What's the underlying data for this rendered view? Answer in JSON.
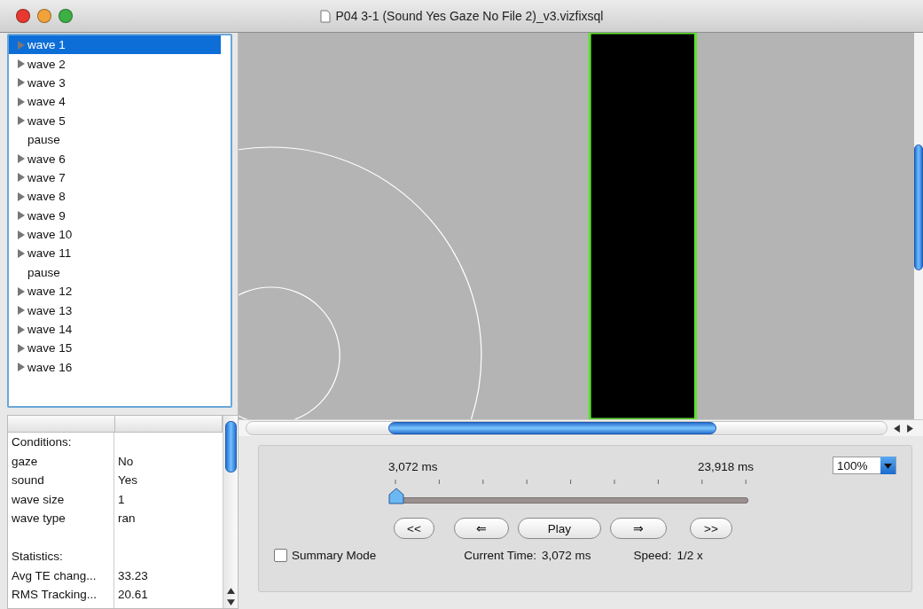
{
  "window": {
    "title": "P04 3-1 (Sound Yes Gaze No File 2)_v3.vizfixsql"
  },
  "tree": [
    {
      "label": "wave 1",
      "kind": "group",
      "expanded": false,
      "selected": true
    },
    {
      "label": "wave 2",
      "kind": "group",
      "expanded": false,
      "selected": false
    },
    {
      "label": "wave 3",
      "kind": "group",
      "expanded": false,
      "selected": false
    },
    {
      "label": "wave 4",
      "kind": "group",
      "expanded": false,
      "selected": false
    },
    {
      "label": "wave 5",
      "kind": "group",
      "expanded": false,
      "selected": false
    },
    {
      "label": "pause",
      "kind": "leaf",
      "selected": false
    },
    {
      "label": "wave 6",
      "kind": "group",
      "expanded": false,
      "selected": false
    },
    {
      "label": "wave 7",
      "kind": "group",
      "expanded": false,
      "selected": false
    },
    {
      "label": "wave 8",
      "kind": "group",
      "expanded": false,
      "selected": false
    },
    {
      "label": "wave 9",
      "kind": "group",
      "expanded": false,
      "selected": false
    },
    {
      "label": "wave 10",
      "kind": "group",
      "expanded": false,
      "selected": false
    },
    {
      "label": "wave 11",
      "kind": "group",
      "expanded": false,
      "selected": false
    },
    {
      "label": "pause",
      "kind": "leaf",
      "selected": false
    },
    {
      "label": "wave 12",
      "kind": "group",
      "expanded": false,
      "selected": false
    },
    {
      "label": "wave 13",
      "kind": "group",
      "expanded": false,
      "selected": false
    },
    {
      "label": "wave 14",
      "kind": "group",
      "expanded": false,
      "selected": false
    },
    {
      "label": "wave 15",
      "kind": "group",
      "expanded": false,
      "selected": false
    },
    {
      "label": "wave 16",
      "kind": "group",
      "expanded": false,
      "selected": false
    }
  ],
  "table": {
    "rows": [
      {
        "kind": "heading",
        "column_1": "Conditions:"
      },
      {
        "kind": "pair",
        "column_1": "gaze",
        "column_2": "No"
      },
      {
        "kind": "pair",
        "column_1": "sound",
        "column_2": "Yes"
      },
      {
        "kind": "pair",
        "column_1": "wave size",
        "column_2": "1"
      },
      {
        "kind": "pair",
        "column_1": "wave type",
        "column_2": "ran"
      },
      {
        "kind": "blank"
      },
      {
        "kind": "heading",
        "column_1": "Statistics:"
      },
      {
        "kind": "pair",
        "column_1": "Avg TE chang...",
        "column_2": "33.23"
      },
      {
        "kind": "pair",
        "column_1": "RMS Tracking...",
        "column_2": "20.61"
      }
    ]
  },
  "controls": {
    "start_time": "3,072 ms",
    "end_time": "23,918 ms",
    "zoom": "100%",
    "slider": {
      "level": 0
    },
    "buttons": [
      "<<",
      "⇐",
      "Play",
      "⇒",
      ">>"
    ],
    "summary_mode": {
      "label": "Summary Mode",
      "checked": false
    },
    "current_time_label": "Current Time:",
    "current_time": "3,072 ms",
    "speed_label": "Speed:",
    "speed": "1/2 x"
  }
}
